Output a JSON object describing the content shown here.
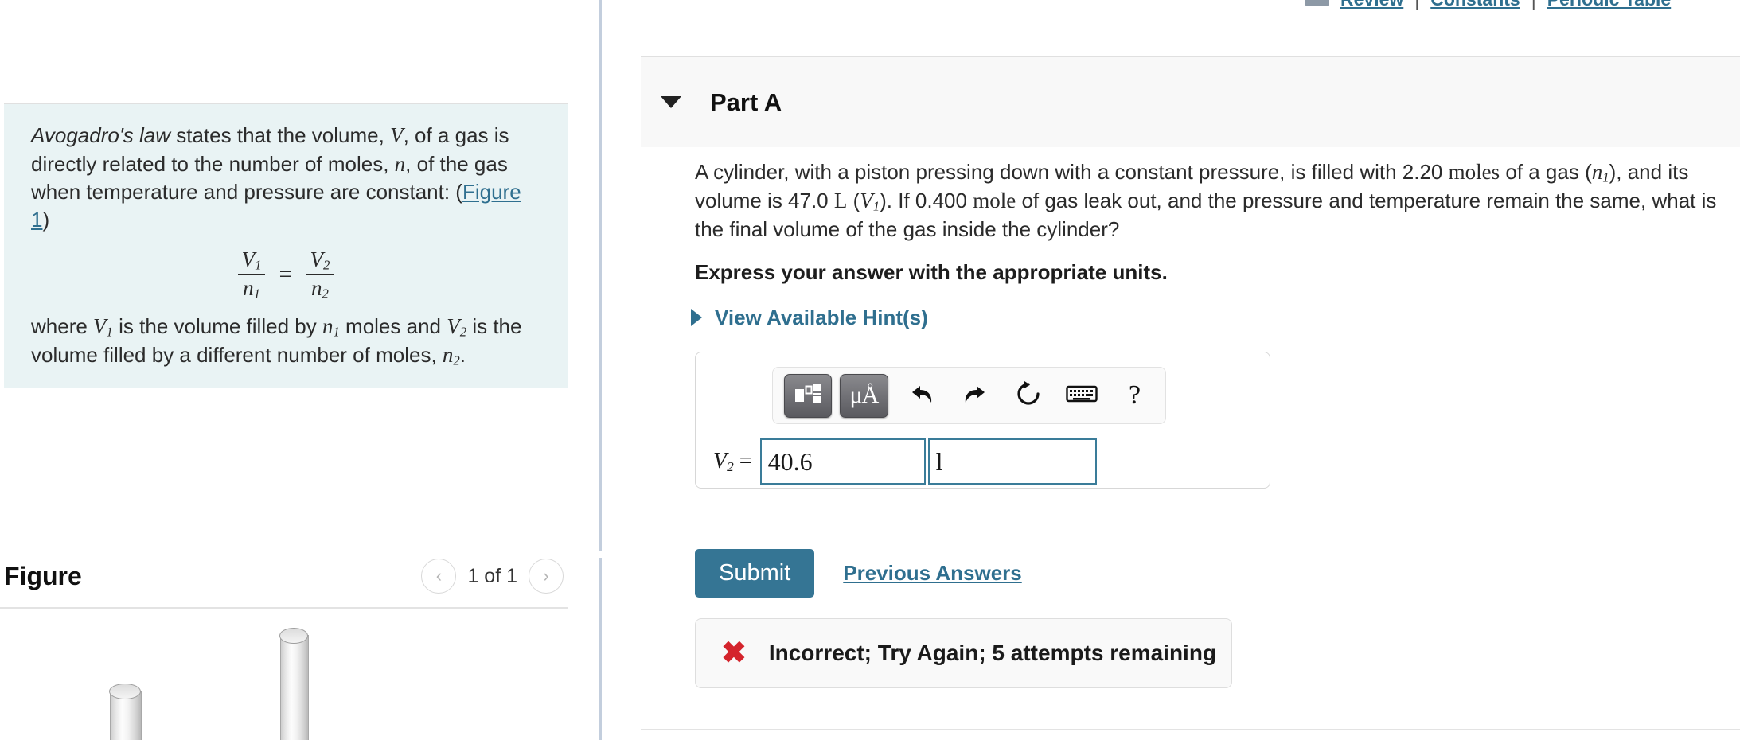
{
  "top_nav": {
    "links": [
      "Review",
      "Constants",
      "Periodic Table"
    ],
    "separator": "|"
  },
  "left_panel": {
    "info": {
      "law_name": "Avogadro's law",
      "sentence_part1": " states that the volume, ",
      "var_V": "V",
      "sentence_part2": ", of a gas is directly related to the number of moles, ",
      "var_n": "n",
      "sentence_part3": ", of the gas when temperature and pressure are constant: (",
      "figure_link": "Figure 1",
      "sentence_part4": ")",
      "equation": {
        "left_num": "V",
        "left_num_sub": "1",
        "left_den": "n",
        "left_den_sub": "1",
        "equals": "=",
        "right_num": "V",
        "right_num_sub": "2",
        "right_den": "n",
        "right_den_sub": "2"
      },
      "where_part1": "where ",
      "where_V1": "V",
      "where_V1_sub": "1",
      "where_part2": " is the volume filled by ",
      "where_n1": "n",
      "where_n1_sub": "1",
      "where_part3": " moles and ",
      "where_V2": "V",
      "where_V2_sub": "2",
      "where_part4": " is the volume filled by a different number of moles, ",
      "where_n2": "n",
      "where_n2_sub": "2",
      "where_part5": "."
    },
    "figure": {
      "title": "Figure",
      "count_label": "1 of 1",
      "prev_icon": "chevron-left-icon",
      "next_icon": "chevron-right-icon"
    }
  },
  "right_panel": {
    "part": {
      "title": "Part A",
      "collapse_icon": "caret-down-icon"
    },
    "question": {
      "text_part1": "A cylinder, with a piston pressing down with a constant pressure, is filled with 2.20 ",
      "moles_word": "moles",
      "text_part2": " of a gas (",
      "n1": "n",
      "n1_sub": "1",
      "text_part3": "), and its volume is 47.0 ",
      "liter_unit": "L",
      "text_part4": " (",
      "V1": "V",
      "V1_sub": "1",
      "text_part5": "). If 0.400 ",
      "mole_word": "mole",
      "text_part6": " of gas leak out, and the pressure and temperature remain the same, what is the final volume of the gas inside the cylinder?"
    },
    "instruction": "Express your answer with the appropriate units.",
    "hints": {
      "label": "View Available Hint(s)",
      "icon": "caret-right-icon"
    },
    "answer_widget": {
      "toolbar": {
        "template_button": "math-template-icon",
        "units_button": "μÅ",
        "units_button_name": "units-icon",
        "undo": "undo-icon",
        "redo": "redo-icon",
        "reset": "reset-icon",
        "keyboard": "keyboard-icon",
        "help": "?"
      },
      "label_var": "V",
      "label_sub": "2",
      "label_equals": "=",
      "value": "40.6",
      "unit": "l",
      "value_placeholder": "",
      "unit_placeholder": ""
    },
    "actions": {
      "submit_label": "Submit",
      "previous_answers_label": "Previous Answers"
    },
    "feedback": {
      "icon": "x-mark-icon",
      "message": "Incorrect; Try Again; 5 attempts remaining"
    }
  },
  "colors": {
    "accent_teal": "#2f6f8f",
    "submit_bg": "#357594",
    "info_bg": "#e9f3f4",
    "input_border": "#3a7c99",
    "error_red": "#d4242c",
    "splitter": "#c3cedd"
  }
}
